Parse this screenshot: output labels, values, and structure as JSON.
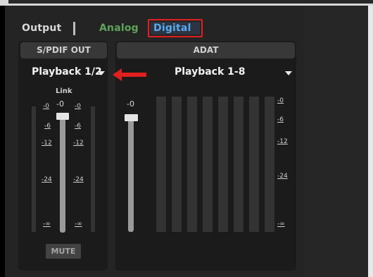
{
  "tabs": {
    "output": "Output",
    "analog": "Analog",
    "digital": "Digital"
  },
  "panels": {
    "spdif": {
      "title": "S/PDIF OUT",
      "selected": "Playback 1/2",
      "link_label": "Link",
      "mute_label": "MUTE"
    },
    "adat": {
      "title": "ADAT",
      "selected": "Playback 1-8"
    }
  },
  "fader": {
    "level": "-0"
  },
  "scale_left": [
    "-0",
    "-6",
    "-12",
    "-24",
    "-∞"
  ],
  "scale_right": [
    "-0",
    "-6",
    "-12",
    "-24",
    "-∞"
  ],
  "scale_adat": [
    "-0",
    "-6",
    "-12",
    "-24",
    "-∞"
  ],
  "colors": {
    "analog": "#5fa35a",
    "digital": "#5aa8f0",
    "highlight": "#e01f1f"
  },
  "icons": {
    "dropdown": "chevron-down-icon",
    "annotation": "red-arrow-icon"
  }
}
